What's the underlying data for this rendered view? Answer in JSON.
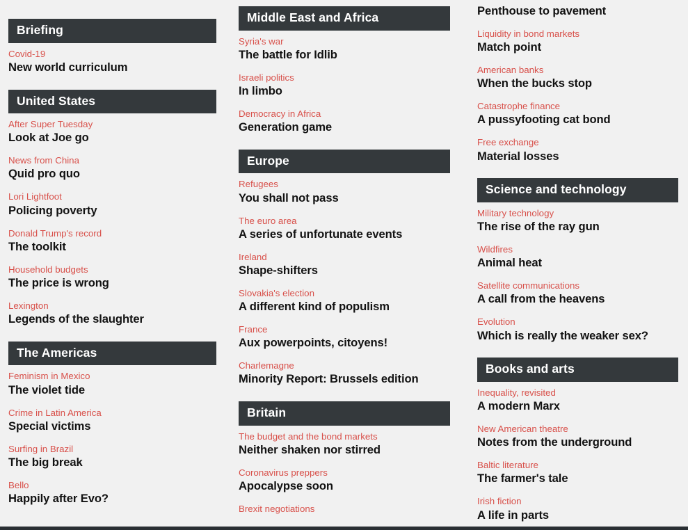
{
  "page": {
    "background_color": "#f1f1f1",
    "header_bar_color": "#34393c",
    "rubric_color": "#d8504a",
    "headline_color": "#121212",
    "bottom_rule_color": "#2a2f33"
  },
  "columns": [
    {
      "id": "column-left",
      "sections": [
        {
          "id": "section-briefing",
          "title": "Briefing",
          "articles": [
            {
              "rubric": "Covid-19",
              "headline": "New world curriculum"
            }
          ]
        },
        {
          "id": "section-united-states",
          "title": "United States",
          "articles": [
            {
              "rubric": "After Super Tuesday",
              "headline": "Look at Joe go"
            },
            {
              "rubric": "News from China",
              "headline": "Quid pro quo"
            },
            {
              "rubric": "Lori Lightfoot",
              "headline": "Policing poverty"
            },
            {
              "rubric": "Donald Trump's record",
              "headline": "The toolkit"
            },
            {
              "rubric": "Household budgets",
              "headline": "The price is wrong"
            },
            {
              "rubric": "Lexington",
              "headline": "Legends of the slaughter"
            }
          ]
        },
        {
          "id": "section-the-americas",
          "title": "The Americas",
          "articles": [
            {
              "rubric": "Feminism in Mexico",
              "headline": "The violet tide"
            },
            {
              "rubric": "Crime in Latin America",
              "headline": "Special victims"
            },
            {
              "rubric": "Surfing in Brazil",
              "headline": "The big break"
            },
            {
              "rubric": "Bello",
              "headline": "Happily after Evo?"
            }
          ]
        }
      ]
    },
    {
      "id": "column-middle",
      "sections": [
        {
          "id": "section-middle-east-and-africa",
          "title": "Middle East and Africa",
          "articles": [
            {
              "rubric": "Syria's war",
              "headline": "The battle for Idlib"
            },
            {
              "rubric": "Israeli politics",
              "headline": "In limbo"
            },
            {
              "rubric": "Democracy in Africa",
              "headline": "Generation game"
            }
          ]
        },
        {
          "id": "section-europe",
          "title": "Europe",
          "articles": [
            {
              "rubric": "Refugees",
              "headline": "You shall not pass"
            },
            {
              "rubric": "The euro area",
              "headline": "A series of unfortunate events"
            },
            {
              "rubric": "Ireland",
              "headline": "Shape-shifters"
            },
            {
              "rubric": "Slovakia's election",
              "headline": "A different kind of populism"
            },
            {
              "rubric": "France",
              "headline": "Aux powerpoints, citoyens!"
            },
            {
              "rubric": "Charlemagne",
              "headline": "Minority Report: Brussels edition"
            }
          ]
        },
        {
          "id": "section-britain",
          "title": "Britain",
          "articles": [
            {
              "rubric": "The budget and the bond markets",
              "headline": "Neither shaken nor stirred"
            },
            {
              "rubric": "Coronavirus preppers",
              "headline": "Apocalypse soon"
            },
            {
              "rubric": "Brexit negotiations",
              "headline": ""
            }
          ]
        }
      ]
    },
    {
      "id": "column-right",
      "sections": [
        {
          "id": "section-finance-continued",
          "title": "",
          "articles": [
            {
              "rubric": "",
              "headline": "Penthouse to pavement"
            },
            {
              "rubric": "Liquidity in bond markets",
              "headline": "Match point"
            },
            {
              "rubric": "American banks",
              "headline": "When the bucks stop"
            },
            {
              "rubric": "Catastrophe finance",
              "headline": "A pussyfooting cat bond"
            },
            {
              "rubric": "Free exchange",
              "headline": "Material losses"
            }
          ]
        },
        {
          "id": "section-science-and-technology",
          "title": "Science and technology",
          "articles": [
            {
              "rubric": "Military technology",
              "headline": "The rise of the ray gun"
            },
            {
              "rubric": "Wildfires",
              "headline": "Animal heat"
            },
            {
              "rubric": "Satellite communications",
              "headline": "A call from the heavens"
            },
            {
              "rubric": "Evolution",
              "headline": "Which is really the weaker sex?"
            }
          ]
        },
        {
          "id": "section-books-and-arts",
          "title": "Books and arts",
          "articles": [
            {
              "rubric": "Inequality, revisited",
              "headline": "A modern Marx"
            },
            {
              "rubric": "New American theatre",
              "headline": "Notes from the underground"
            },
            {
              "rubric": "Baltic literature",
              "headline": "The farmer's tale"
            },
            {
              "rubric": "Irish fiction",
              "headline": "A life in parts"
            }
          ]
        }
      ]
    }
  ]
}
